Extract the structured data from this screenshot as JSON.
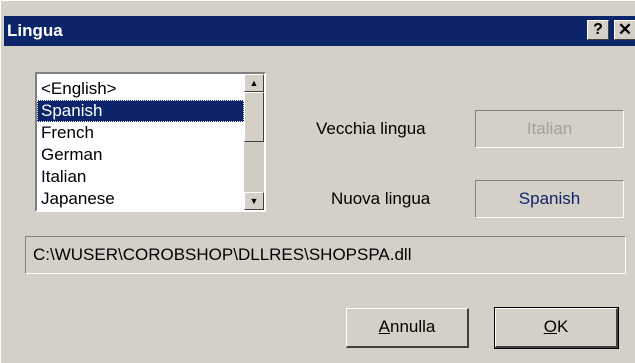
{
  "window": {
    "title": "Lingua",
    "help_glyph": "?",
    "close_glyph": "✕"
  },
  "language_list": {
    "items": [
      "<English>",
      "Spanish",
      "French",
      "German",
      "Italian",
      "Japanese"
    ],
    "selected_index": 1,
    "scroll_up_glyph": "▲",
    "scroll_down_glyph": "▼"
  },
  "old_language": {
    "label": "Vecchia lingua",
    "value": "Italian"
  },
  "new_language": {
    "label": "Nuova lingua",
    "value": "Spanish"
  },
  "dll_path": "C:\\WUSER\\COROBSHOP\\DLLRES\\SHOPSPA.dll",
  "buttons": {
    "cancel_mnemonic": "A",
    "cancel_rest": "nnulla",
    "ok_mnemonic": "O",
    "ok_rest": "K"
  },
  "colors": {
    "titlebar": "#0b246a",
    "face": "#d4d0c8",
    "selection": "#0b246a",
    "new_value_text": "#0b246a",
    "old_value_text": "#a0a0a0"
  }
}
